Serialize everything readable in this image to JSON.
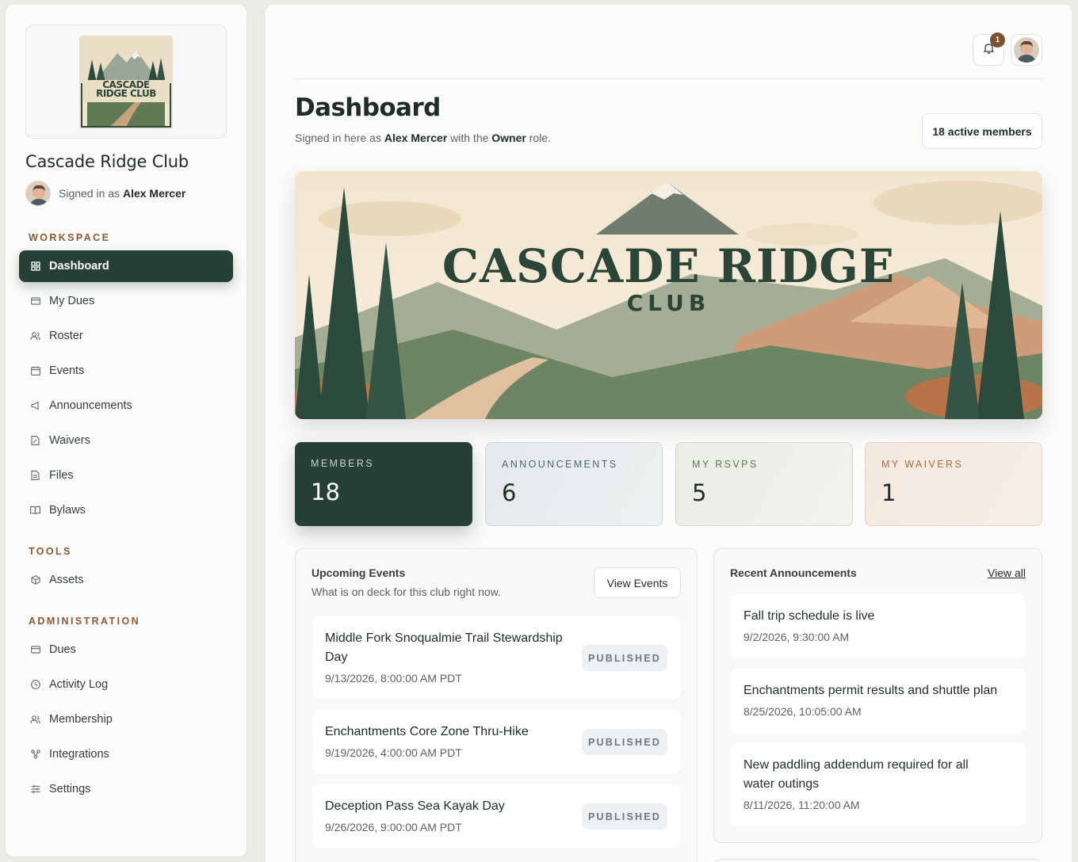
{
  "sidebar": {
    "logo_text": "CASCADE RIDGE CLUB",
    "club_name": "Cascade Ridge Club",
    "signed_in_prefix": "Signed in as",
    "user_name": "Alex Mercer",
    "sections": {
      "workspace": "WORKSPACE",
      "tools": "TOOLS",
      "administration": "ADMINISTRATION"
    },
    "items": [
      {
        "label": "Dashboard",
        "icon": "grid-icon",
        "active": true
      },
      {
        "label": "My Dues",
        "icon": "card-icon"
      },
      {
        "label": "Roster",
        "icon": "users-icon"
      },
      {
        "label": "Events",
        "icon": "calendar-icon"
      },
      {
        "label": "Announcements",
        "icon": "megaphone-icon"
      },
      {
        "label": "Waivers",
        "icon": "document-sign-icon"
      },
      {
        "label": "Files",
        "icon": "file-icon"
      },
      {
        "label": "Bylaws",
        "icon": "book-icon"
      },
      {
        "label": "Assets",
        "icon": "cube-icon"
      },
      {
        "label": "Dues",
        "icon": "card-icon"
      },
      {
        "label": "Activity Log",
        "icon": "clock-icon"
      },
      {
        "label": "Membership",
        "icon": "users-icon"
      },
      {
        "label": "Integrations",
        "icon": "nodes-icon"
      },
      {
        "label": "Settings",
        "icon": "sliders-icon"
      }
    ]
  },
  "header": {
    "notification_count": "1",
    "title": "Dashboard",
    "subtitle_a": "Signed in here as",
    "subtitle_user": "Alex Mercer",
    "subtitle_b": "with the",
    "subtitle_role": "Owner",
    "subtitle_c": "role.",
    "active_members": "18 active members"
  },
  "banner": {
    "title_line1": "CASCADE RIDGE",
    "title_line2": "CLUB"
  },
  "stats": [
    {
      "label": "MEMBERS",
      "value": "18"
    },
    {
      "label": "ANNOUNCEMENTS",
      "value": "6"
    },
    {
      "label": "MY RSVPS",
      "value": "5"
    },
    {
      "label": "MY WAIVERS",
      "value": "1"
    }
  ],
  "events_panel": {
    "title": "Upcoming Events",
    "subtitle": "What is on deck for this club right now.",
    "button": "View Events",
    "items": [
      {
        "title": "Middle Fork Snoqualmie Trail Stewardship Day",
        "date": "9/13/2026, 8:00:00 AM PDT",
        "status": "PUBLISHED"
      },
      {
        "title": "Enchantments Core Zone Thru-Hike",
        "date": "9/19/2026, 4:00:00 AM PDT",
        "status": "PUBLISHED"
      },
      {
        "title": "Deception Pass Sea Kayak Day",
        "date": "9/26/2026, 9:00:00 AM PDT",
        "status": "PUBLISHED"
      }
    ]
  },
  "announcements_panel": {
    "title": "Recent Announcements",
    "link": "View all",
    "items": [
      {
        "title": "Fall trip schedule is live",
        "date": "9/2/2026, 9:30:00 AM"
      },
      {
        "title": "Enchantments permit results and shuttle plan",
        "date": "8/25/2026, 10:05:00 AM"
      },
      {
        "title": "New paddling addendum required for all water outings",
        "date": "8/11/2026, 11:20:00 AM"
      }
    ]
  },
  "colors": {
    "primary": "#263f37",
    "accent_brown": "#8a5a33",
    "badge": "#7a5131"
  }
}
